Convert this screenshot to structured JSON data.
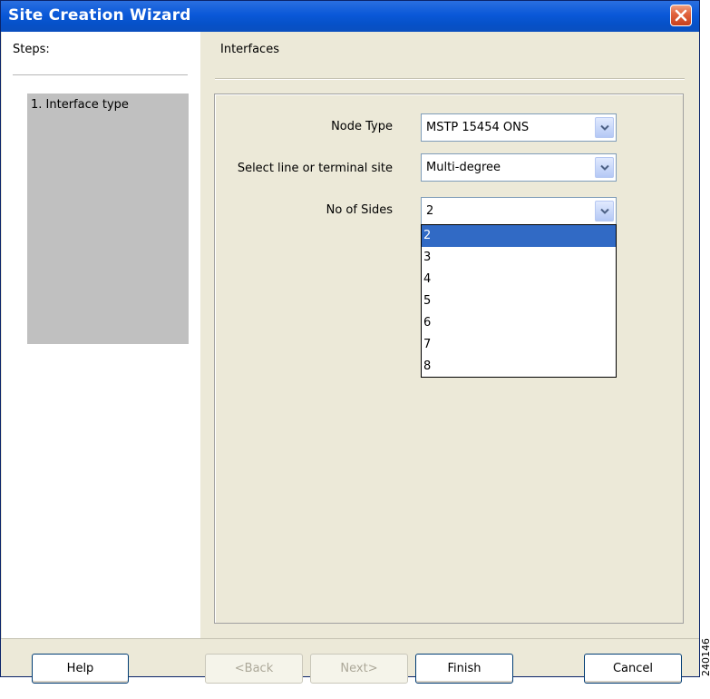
{
  "window": {
    "title": "Site Creation Wizard"
  },
  "steps": {
    "header": "Steps:",
    "items": [
      "1. Interface type"
    ]
  },
  "main": {
    "header": "Interfaces",
    "fields": [
      {
        "label": "Node Type",
        "value": "MSTP 15454 ONS"
      },
      {
        "label": "Select line or terminal site",
        "value": "Multi-degree"
      },
      {
        "label": "No of Sides",
        "value": "2"
      }
    ],
    "sides_options": [
      "2",
      "3",
      "4",
      "5",
      "6",
      "7",
      "8"
    ]
  },
  "buttons": {
    "help": "Help",
    "back": "<Back",
    "next": "Next>",
    "finish": "Finish",
    "cancel": "Cancel"
  },
  "watermark": "240146",
  "colors": {
    "titlebar": "#0a58d8",
    "selection": "#316ac5",
    "dialog_bg": "#ece9d8"
  }
}
